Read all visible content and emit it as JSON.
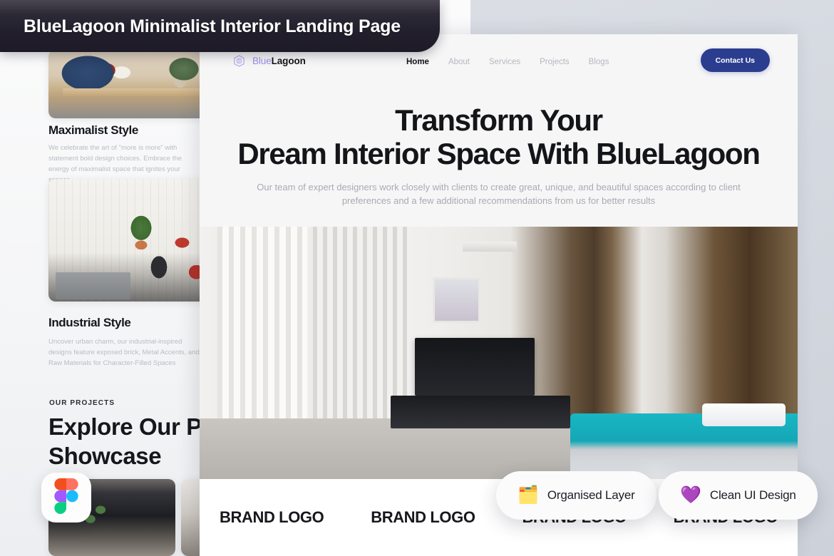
{
  "titlebar": {
    "title": "BlueLagoon Minimalist Interior Landing Page"
  },
  "nav": {
    "logo": {
      "icon": "house-b-logo-icon",
      "word_first": "Blue",
      "word_second": "Lagoon"
    },
    "links": [
      {
        "label": "Home",
        "active": true
      },
      {
        "label": "About",
        "active": false
      },
      {
        "label": "Services",
        "active": false
      },
      {
        "label": "Projects",
        "active": false
      },
      {
        "label": "Blogs",
        "active": false
      }
    ],
    "cta": {
      "label": "Contact Us",
      "color": "#2b3d8f"
    }
  },
  "hero": {
    "heading_line1": "Transform Your",
    "heading_line2": "Dream Interior Space With BlueLagoon",
    "subtext": "Our team of expert designers work closely with clients to create great, unique, and beautiful spaces according to client preferences and a few additional recommendations from us for better results",
    "image_alt": "modern-bedroom-interior-photo"
  },
  "brands": {
    "items": [
      "BRAND LOGO",
      "BRAND LOGO",
      "BRAND LOGO",
      "BRAND LOGO"
    ]
  },
  "pills": [
    {
      "glyph": "🗂️",
      "icon": "folder-icon",
      "label": "Organised Layer"
    },
    {
      "glyph": "💜",
      "icon": "purple-heart-icon",
      "label": "Clean UI Design"
    }
  ],
  "backdrop": {
    "sections": [
      {
        "title": "Maximalist Style",
        "body": "We celebrate the art of \"more is more\" with statement bold design choices. Embrace the energy of maximalist space that ignites your senses.",
        "image_alt": "maximalist-dining-room-photo"
      },
      {
        "title": "Industrial Style",
        "body": "Uncover urban charm, our industrial-inspired designs feature exposed brick, Metal Accents, and Raw Materials for Character-Filled Spaces",
        "image_alt": "industrial-studio-workshop-photo"
      }
    ],
    "projects": {
      "eyebrow": "OUR PROJECTS",
      "heading_line1": "Explore Our Proj",
      "heading_line2": "Showcase",
      "thumbnails": [
        "dark-kitchen-photo",
        "light-interior-photo"
      ]
    },
    "figma_badge": {
      "icon": "figma-logo-icon"
    }
  },
  "colors": {
    "accent_purple": "#9d8fe8",
    "cta_navy": "#2b3d8f",
    "titlebar_dark": "#221f2c",
    "page_bg": "#d6dae1"
  }
}
